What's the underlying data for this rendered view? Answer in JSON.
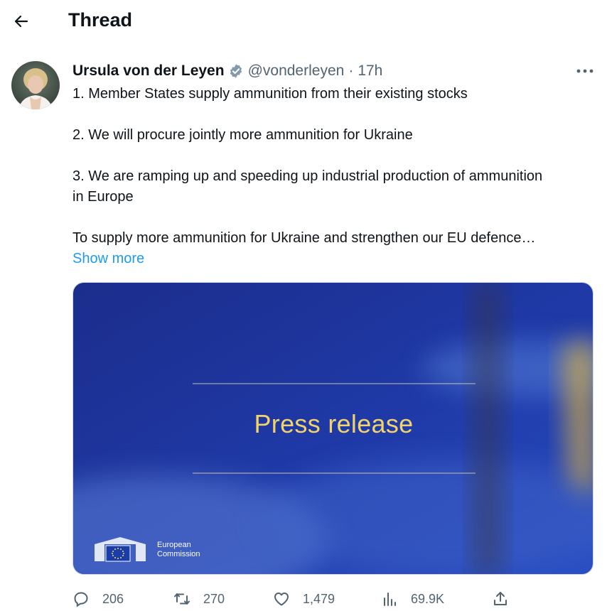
{
  "header": {
    "title": "Thread"
  },
  "tweet": {
    "author_name": "Ursula von der Leyen",
    "handle": "@vonderleyen",
    "separator": "·",
    "time": "17h",
    "lines": [
      "1. Member States supply ammunition from their existing stocks",
      "2. We will procure jointly more ammunition for Ukraine",
      "3. We are ramping up and speeding up industrial production of ammunition in Europe",
      "To supply more ammunition for Ukraine and strengthen our EU defence…"
    ],
    "show_more": "Show more"
  },
  "media": {
    "title": "Press release",
    "logo_line1": "European",
    "logo_line2": "Commission"
  },
  "actions": {
    "replies": "206",
    "retweets": "270",
    "likes": "1,479",
    "views": "69.9K"
  },
  "colors": {
    "link": "#1d9bf0",
    "secondary_text": "#536471",
    "verified_badge": "#829aab",
    "press_text": "#f2d36b",
    "media_blue": "#1a2f9a"
  },
  "icons": {
    "back": "arrow-left-icon",
    "verified": "verified-badge-icon",
    "more": "more-horizontal-icon",
    "reply": "reply-icon",
    "retweet": "retweet-icon",
    "like": "heart-icon",
    "views": "views-chart-icon",
    "share": "share-icon"
  }
}
